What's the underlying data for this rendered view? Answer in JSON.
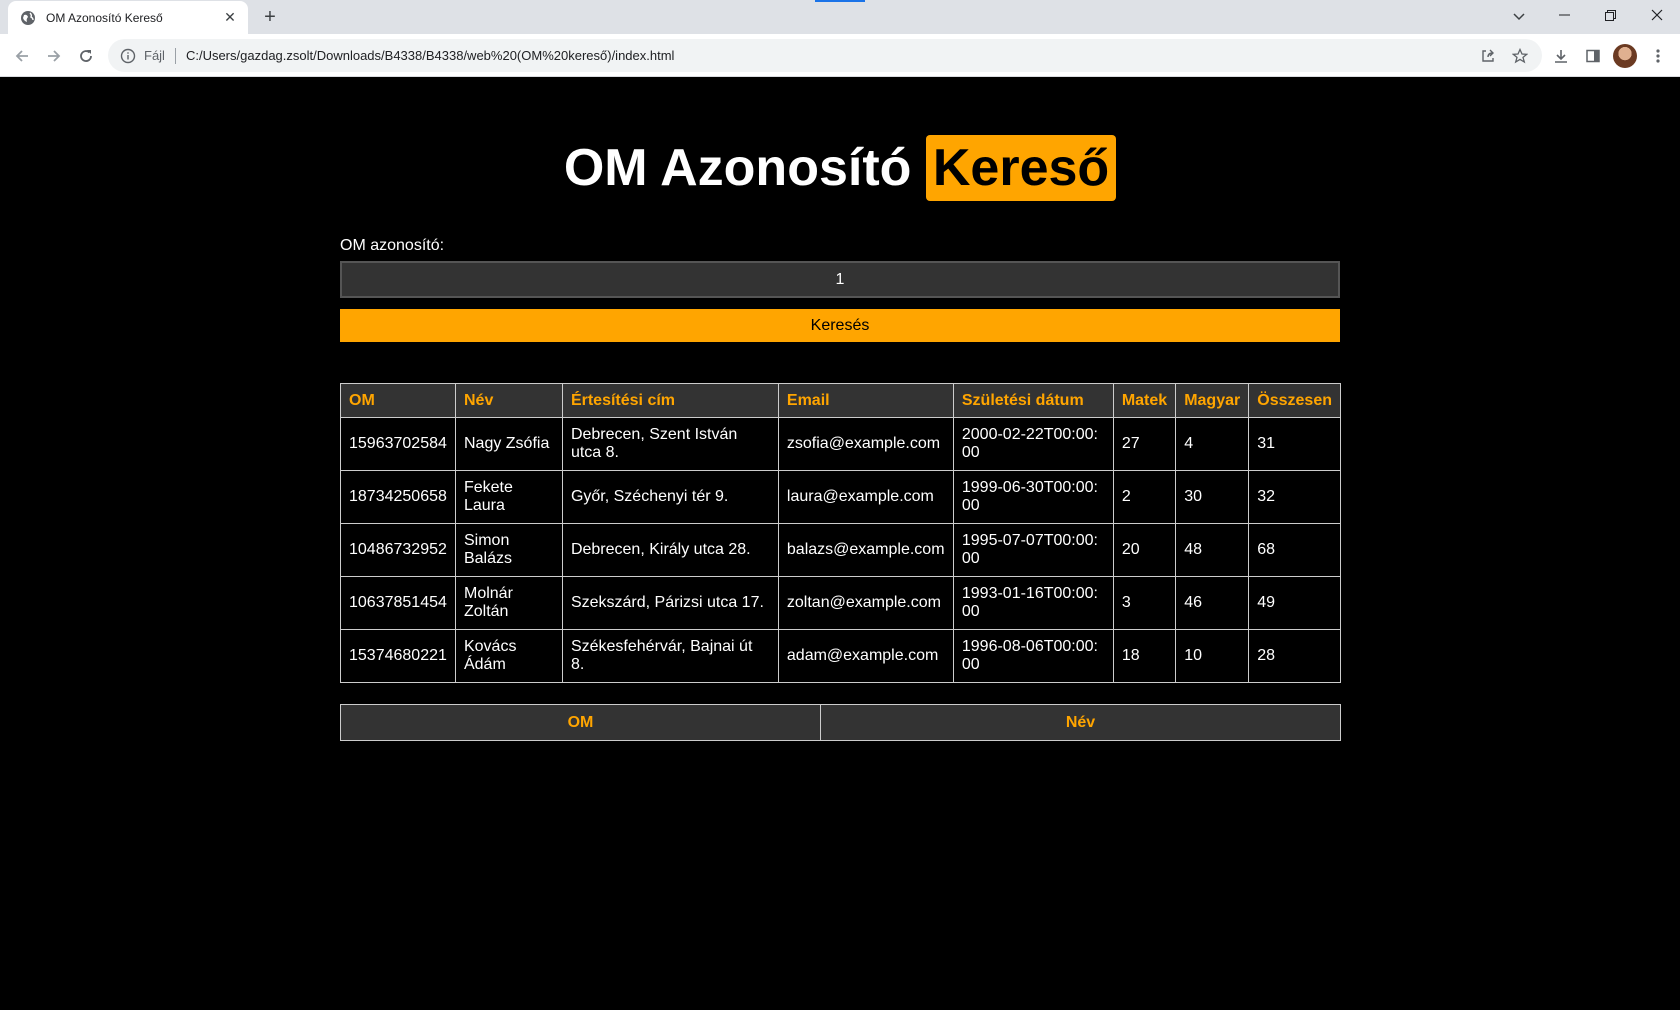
{
  "browser": {
    "tab_title": "OM Azonosító Kereső",
    "new_tab": "+",
    "scheme_label": "Fájl",
    "url": "C:/Users/gazdag.zsolt/Downloads/B4338/B4338/web%20(OM%20kereső)/index.html",
    "accent_color": "#1a73e8"
  },
  "page": {
    "title_main": "OM Azonosító",
    "title_highlight": "Kereső",
    "accent_color": "#ffa500",
    "form": {
      "label": "OM azonosító:",
      "input_value": "1",
      "search_button": "Keresés"
    },
    "table": {
      "headers": [
        "OM",
        "Név",
        "Értesítési cím",
        "Email",
        "Születési dátum",
        "Matek",
        "Magyar",
        "Összesen"
      ],
      "rows": [
        [
          "15963702584",
          "Nagy Zsófia",
          "Debrecen, Szent István utca 8.",
          "zsofia@example.com",
          "2000-02-22T00:00:00",
          "27",
          "4",
          "31"
        ],
        [
          "18734250658",
          "Fekete Laura",
          "Győr, Széchenyi tér 9.",
          "laura@example.com",
          "1999-06-30T00:00:00",
          "2",
          "30",
          "32"
        ],
        [
          "10486732952",
          "Simon Balázs",
          "Debrecen, Király utca 28.",
          "balazs@example.com",
          "1995-07-07T00:00:00",
          "20",
          "48",
          "68"
        ],
        [
          "10637851454",
          "Molnár Zoltán",
          "Szekszárd, Párizsi utca 17.",
          "zoltan@example.com",
          "1993-01-16T00:00:00",
          "3",
          "46",
          "49"
        ],
        [
          "15374680221",
          "Kovács Ádám",
          "Székesfehérvár, Bajnai út 8.",
          "adam@example.com",
          "1996-08-06T00:00:00",
          "18",
          "10",
          "28"
        ]
      ]
    },
    "sort_headers": [
      "OM",
      "Név"
    ]
  }
}
